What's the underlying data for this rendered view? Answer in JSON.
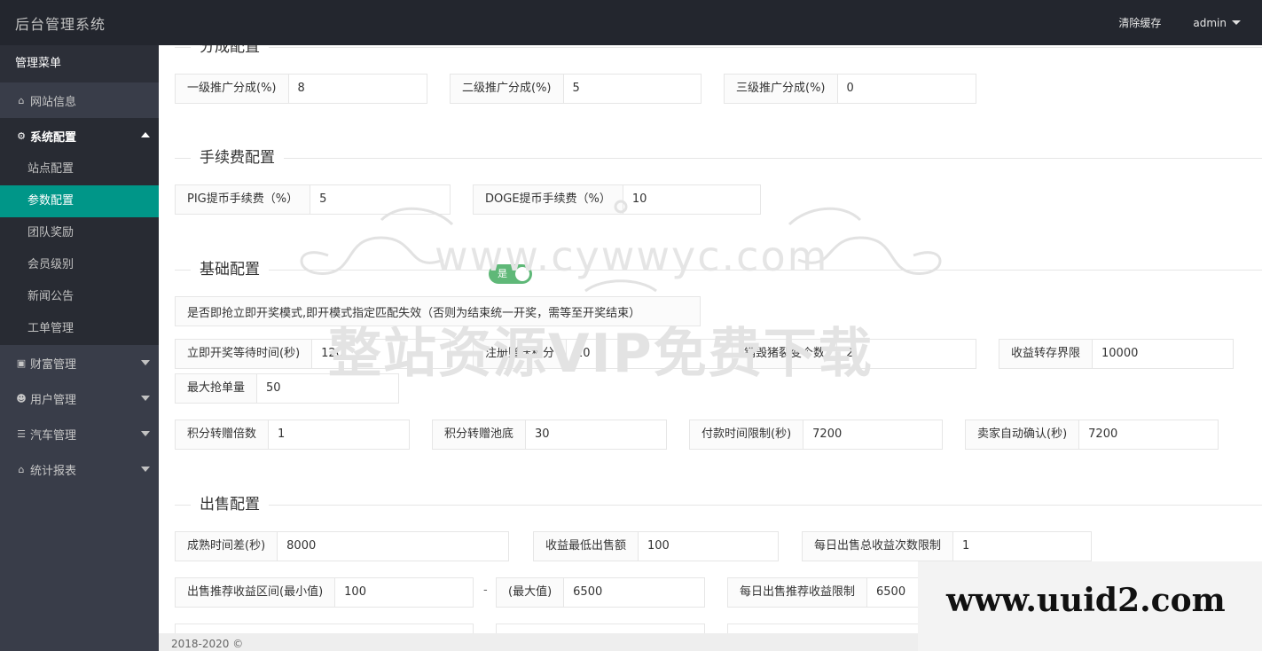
{
  "header": {
    "title": "后台管理系统",
    "clear_cache": "清除缓存",
    "user": "admin"
  },
  "sidebar": {
    "title": "管理菜单",
    "items": [
      {
        "label": "网站信息",
        "icon": "home-icon"
      },
      {
        "label": "系统配置",
        "icon": "gears-icon",
        "expanded": true
      },
      {
        "label": "财富管理",
        "icon": "money-icon"
      },
      {
        "label": "用户管理",
        "icon": "users-icon"
      },
      {
        "label": "汽车管理",
        "icon": "bars-icon"
      },
      {
        "label": "统计报表",
        "icon": "home-icon"
      }
    ],
    "sub_items": [
      "站点配置",
      "参数配置",
      "团队奖励",
      "会员级别",
      "新闻公告",
      "工单管理"
    ],
    "active_sub": "参数配置",
    "accent_color": "#009688"
  },
  "sections": {
    "commission": {
      "title": "分成配置",
      "f1": {
        "label": "一级推广分成(%)",
        "value": "8"
      },
      "f2": {
        "label": "二级推广分成(%)",
        "value": "5"
      },
      "f3": {
        "label": "三级推广分成(%)",
        "value": "0"
      }
    },
    "fee": {
      "title": "手续费配置",
      "f1": {
        "label": "PIG提币手续费（%）",
        "value": "5"
      },
      "f2": {
        "label": "DOGE提币手续费（%）",
        "value": "10"
      }
    },
    "basic": {
      "title": "基础配置",
      "switch_label": "是否即抢立即开奖模式,即开模式指定匹配失效（否则为结束统一开奖，需等至开奖结束）",
      "switch_text": "是",
      "f1": {
        "label": "立即开奖等待时间(秒)",
        "value": "120"
      },
      "f2": {
        "label": "注册赠送积分",
        "value": "10"
      },
      "f3": {
        "label": "销毁猪裂变个数",
        "value": "2"
      },
      "f4": {
        "label": "收益转存界限",
        "value": "10000"
      },
      "f5": {
        "label": "最大抢单量",
        "value": "50"
      },
      "f6": {
        "label": "积分转赠倍数",
        "value": "1"
      },
      "f7": {
        "label": "积分转赠池底",
        "value": "30"
      },
      "f8": {
        "label": "付款时间限制(秒)",
        "value": "7200"
      },
      "f9": {
        "label": "卖家自动确认(秒)",
        "value": "7200"
      }
    },
    "sale": {
      "title": "出售配置",
      "f1": {
        "label": "成熟时间差(秒)",
        "value": "8000"
      },
      "f2": {
        "label": "收益最低出售额",
        "value": "100"
      },
      "f3": {
        "label": "每日出售总收益次数限制",
        "value": "1"
      },
      "f4": {
        "label": "出售推荐收益区间(最小值)",
        "value": "100"
      },
      "dash": "-",
      "f5": {
        "label": "(最大值)",
        "value": "6500"
      },
      "f6": {
        "label": "每日出售推荐收益限制",
        "value": "6500"
      }
    }
  },
  "footer": "2018-2020 ©",
  "watermarks": {
    "url": "www.cywwyc.com",
    "cn": "整站资源VIP免费下载",
    "corner": "www.uuid2.com"
  }
}
